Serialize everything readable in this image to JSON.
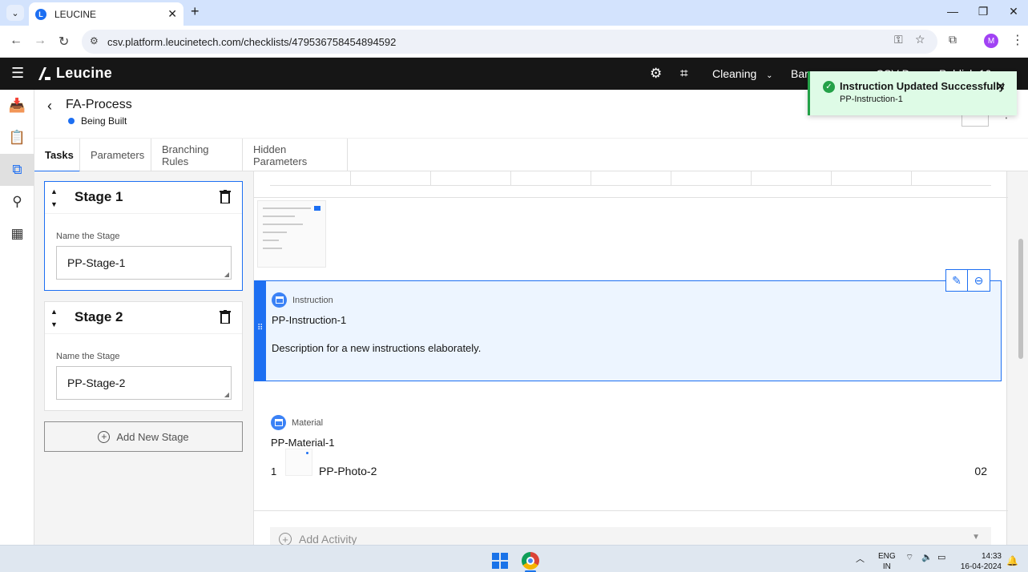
{
  "browser": {
    "tab_title": "LEUCINE",
    "url": "csv.platform.leucinetech.com/checklists/479536758454894592",
    "profile_initial": "M"
  },
  "app": {
    "brand": "Leucine",
    "facility": "Cleaning",
    "partial_header_1": "Bar",
    "partial_header_2": "CSV D",
    "partial_header_3": "Publish 10"
  },
  "page": {
    "title": "FA-Process",
    "status": "Being Built"
  },
  "tabs": [
    {
      "label": "Tasks"
    },
    {
      "label": "Parameters"
    },
    {
      "label": "Branching Rules"
    },
    {
      "label": "Hidden Parameters"
    }
  ],
  "stages": [
    {
      "title": "Stage 1",
      "field_label": "Name the Stage",
      "value": "PP-Stage-1"
    },
    {
      "title": "Stage 2",
      "field_label": "Name the Stage",
      "value": "PP-Stage-2"
    }
  ],
  "add_stage_label": "Add New Stage",
  "activities": {
    "instruction": {
      "type": "Instruction",
      "name": "PP-Instruction-1",
      "description": "Description for a new instructions elaborately."
    },
    "material": {
      "type": "Material",
      "name": "PP-Material-1",
      "items": [
        {
          "index": "1",
          "name": "PP-Photo-2",
          "quantity": "02"
        }
      ]
    }
  },
  "add_activity_label": "Add Activity",
  "toast": {
    "title": "Instruction Updated Successfully",
    "subtitle": "PP-Instruction-1"
  },
  "taskbar": {
    "lang_line1": "ENG",
    "lang_line2": "IN",
    "time": "14:33",
    "date": "16-04-2024"
  },
  "colors": {
    "accent": "#1d6ff2",
    "header_bg": "#161616",
    "success": "#24a148"
  }
}
